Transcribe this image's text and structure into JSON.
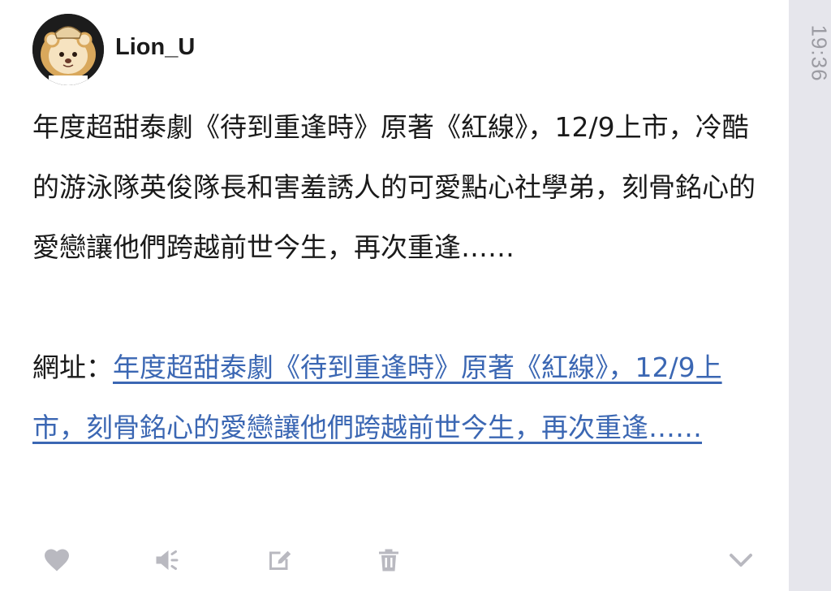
{
  "status_time": "19:36",
  "post": {
    "author": "Lion_U",
    "body": "年度超甜泰劇《待到重逢時》原著《紅線》，12/9上市，冷酷的游泳隊英俊隊長和害羞誘人的可愛點心社學弟，刻骨銘心的愛戀讓他們跨越前世今生，再次重逢……",
    "link_label": "網址：",
    "link_text": "年度超甜泰劇《待到重逢時》原著《紅線》，12/9上市，刻骨銘心的愛戀讓他們跨越前世今生，再次重逢……"
  },
  "actions": {
    "icons": [
      "heart-icon",
      "speaker-icon",
      "edit-icon",
      "trash-icon",
      "chevron-down-icon"
    ]
  },
  "colors": {
    "link": "#3b67b3",
    "icon": "#b9b9c0",
    "sidebar": "#e6e6ec"
  }
}
